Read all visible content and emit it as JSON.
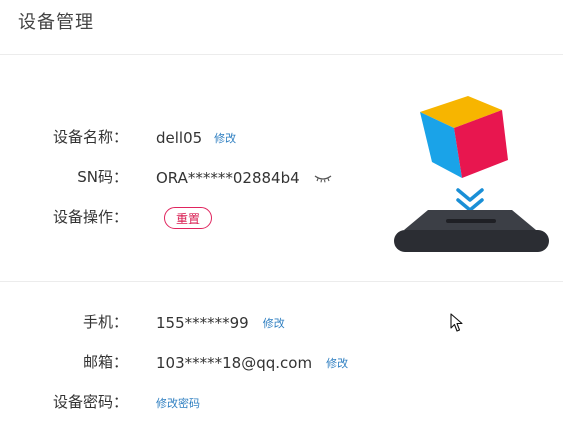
{
  "header": {
    "title": "设备管理"
  },
  "device": {
    "name_label": "设备名称：",
    "name_value": "dell05",
    "name_edit": "修改",
    "sn_label": "SN码：",
    "sn_value": "ORA******02884b4",
    "operation_label": "设备操作：",
    "reset_button": "重置"
  },
  "account": {
    "phone_label": "手机：",
    "phone_value": "155******99",
    "phone_edit": "修改",
    "email_label": "邮箱：",
    "email_value": "103*****18@qq.com",
    "email_edit": "修改",
    "password_label": "设备密码：",
    "password_edit": "修改密码"
  },
  "colors": {
    "link": "#2f7fc1",
    "reset_accent": "#e0245e",
    "divider": "#ececec"
  },
  "icons": {
    "sn_toggle": "eye-closed-icon",
    "illustration": "cube-upload-device-icon",
    "cursor": "mouse-pointer-icon"
  }
}
